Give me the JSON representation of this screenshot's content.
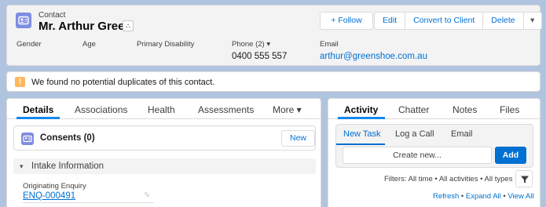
{
  "header": {
    "object_type": "Contact",
    "record_name": "Mr. Arthur Green",
    "hierarchy_glyph": "⛬",
    "buttons": {
      "follow": "+ Follow",
      "edit": "Edit",
      "convert": "Convert to Client",
      "delete": "Delete",
      "more_glyph": "▾"
    },
    "fields": [
      {
        "label": "Gender",
        "value": ""
      },
      {
        "label": "Age",
        "value": ""
      },
      {
        "label": "Primary Disability",
        "value": ""
      },
      {
        "label": "Phone (2) ▾",
        "value": "0400 555 557"
      },
      {
        "label": "Email",
        "value": "arthur@greenshoe.com.au"
      }
    ]
  },
  "alert": {
    "icon_glyph": "!",
    "text": "We found no potential duplicates of this contact."
  },
  "left_tabs": [
    "Details",
    "Associations",
    "Health",
    "Assessments",
    "More ▾"
  ],
  "consents": {
    "title": "Consents (0)",
    "new_label": "New"
  },
  "intake_section": {
    "chevron_glyph": "▾",
    "title": "Intake Information"
  },
  "originating_enquiry": {
    "label": "Originating Enquiry",
    "value": "ENQ-000491",
    "edit_glyph": "✎"
  },
  "right_tabs": [
    "Activity",
    "Chatter",
    "Notes",
    "Files"
  ],
  "composer": {
    "tabs": [
      "New Task",
      "Log a Call",
      "Email"
    ],
    "input_placeholder": "Create new...",
    "add_label": "Add"
  },
  "filters": "Filters: All time • All activities • All types",
  "activity_links": {
    "refresh": "Refresh",
    "expand": "Expand All",
    "view": "View All",
    "separator": "•"
  },
  "colors": {
    "background": "#b0c4df",
    "brand_blue": "#0070d2",
    "contact_icon": "#7f8de1",
    "warning": "#ffb75d",
    "tab_active_underline": "#1589ee"
  }
}
